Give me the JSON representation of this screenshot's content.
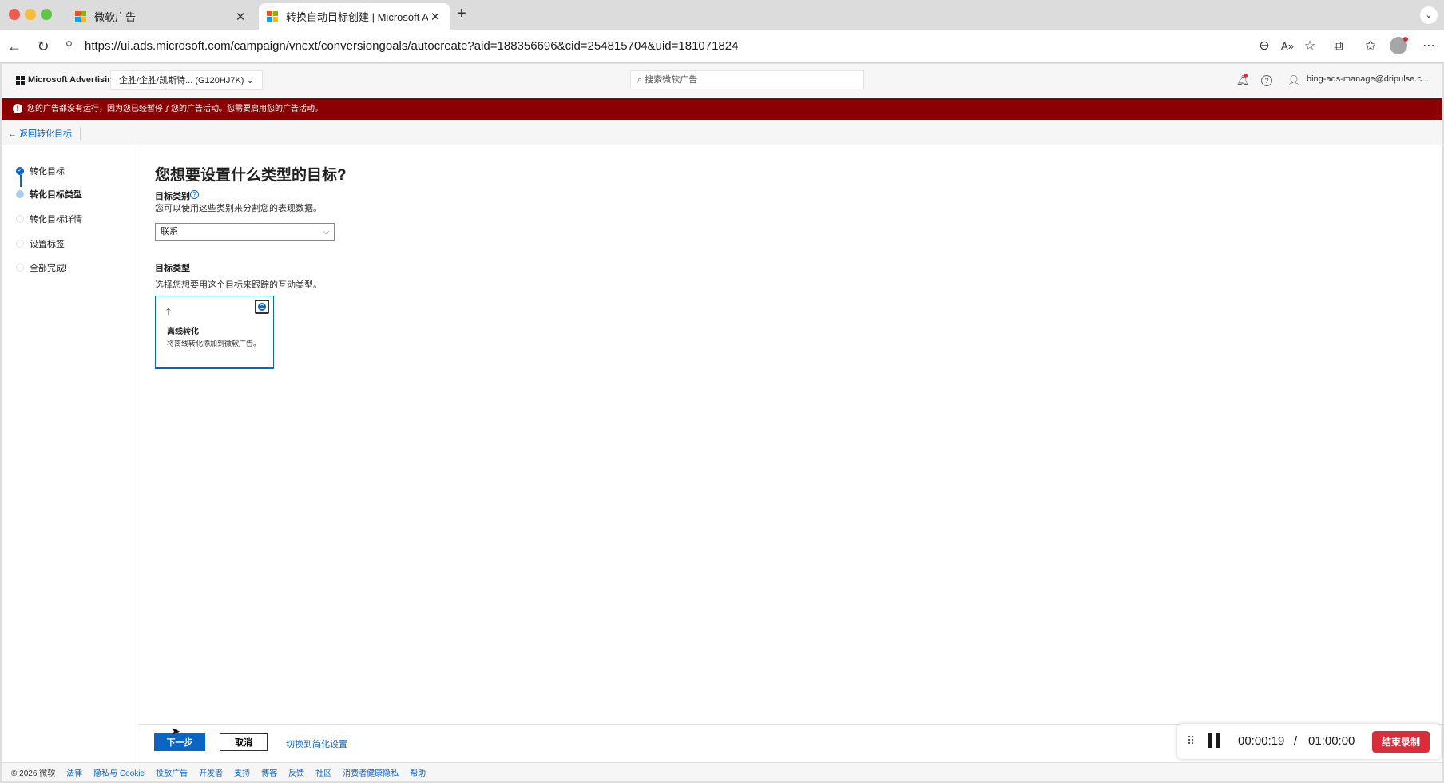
{
  "browser": {
    "tabs": [
      {
        "title": "微软广告",
        "active": false
      },
      {
        "title": "转换自动目标创建 | Microsoft Ads",
        "active": true
      }
    ],
    "url": "https://ui.ads.microsoft.com/campaign/vnext/conversiongoals/autocreate?aid=188356696&cid=254815704&uid=181071824",
    "icons": [
      "back-icon",
      "reload-icon",
      "zoom-out-icon",
      "read-aloud-icon",
      "favorite-icon",
      "extensions-icon",
      "favorites-bar-icon",
      "profile-icon",
      "more-icon"
    ]
  },
  "colors": {
    "accent": "#0a66c2",
    "alert_bg": "#8b0000",
    "stop_button": "#d92d3a"
  },
  "header": {
    "brand": "Microsoft Advertising",
    "account_selector": "企胜/企胜/凯斯特... (G120HJ7K) ⌄",
    "search_placeholder": "搜索微软广告",
    "user_email": "bing-ads-manage@dripulse.c..."
  },
  "alert": {
    "message": "您的广告都没有运行，因为您已经暂停了您的广告活动。您需要启用您的广告活动。"
  },
  "back_link": "返回转化目标",
  "steps": [
    {
      "label": "转化目标",
      "state": "done"
    },
    {
      "label": "转化目标类型",
      "state": "current"
    },
    {
      "label": "转化目标详情",
      "state": "todo"
    },
    {
      "label": "设置标签",
      "state": "todo"
    },
    {
      "label": "全部完成!",
      "state": "todo"
    }
  ],
  "main": {
    "heading": "您想要设置什么类型的目标?",
    "category_label": "目标类别",
    "category_desc": "您可以使用这些类别来分割您的表现数据。",
    "category_value": "联系",
    "type_label": "目标类型",
    "type_desc": "选择您想要用这个目标来跟踪的互动类型。",
    "card": {
      "title": "离线转化",
      "desc": "将离线转化添加到微软广告。",
      "selected": true
    }
  },
  "actions": {
    "next": "下一步",
    "cancel": "取消",
    "switch_simple": "切换到简化设置"
  },
  "recorder": {
    "elapsed": "00:00:19",
    "separator": "/",
    "limit": "01:00:00",
    "stop": "结束录制"
  },
  "footer": {
    "copyright": "© 2026 微软",
    "links": [
      "法律",
      "隐私与 Cookie",
      "投放广告",
      "开发者",
      "支持",
      "博客",
      "反馈",
      "社区",
      "消费者健康隐私",
      "帮助"
    ]
  }
}
